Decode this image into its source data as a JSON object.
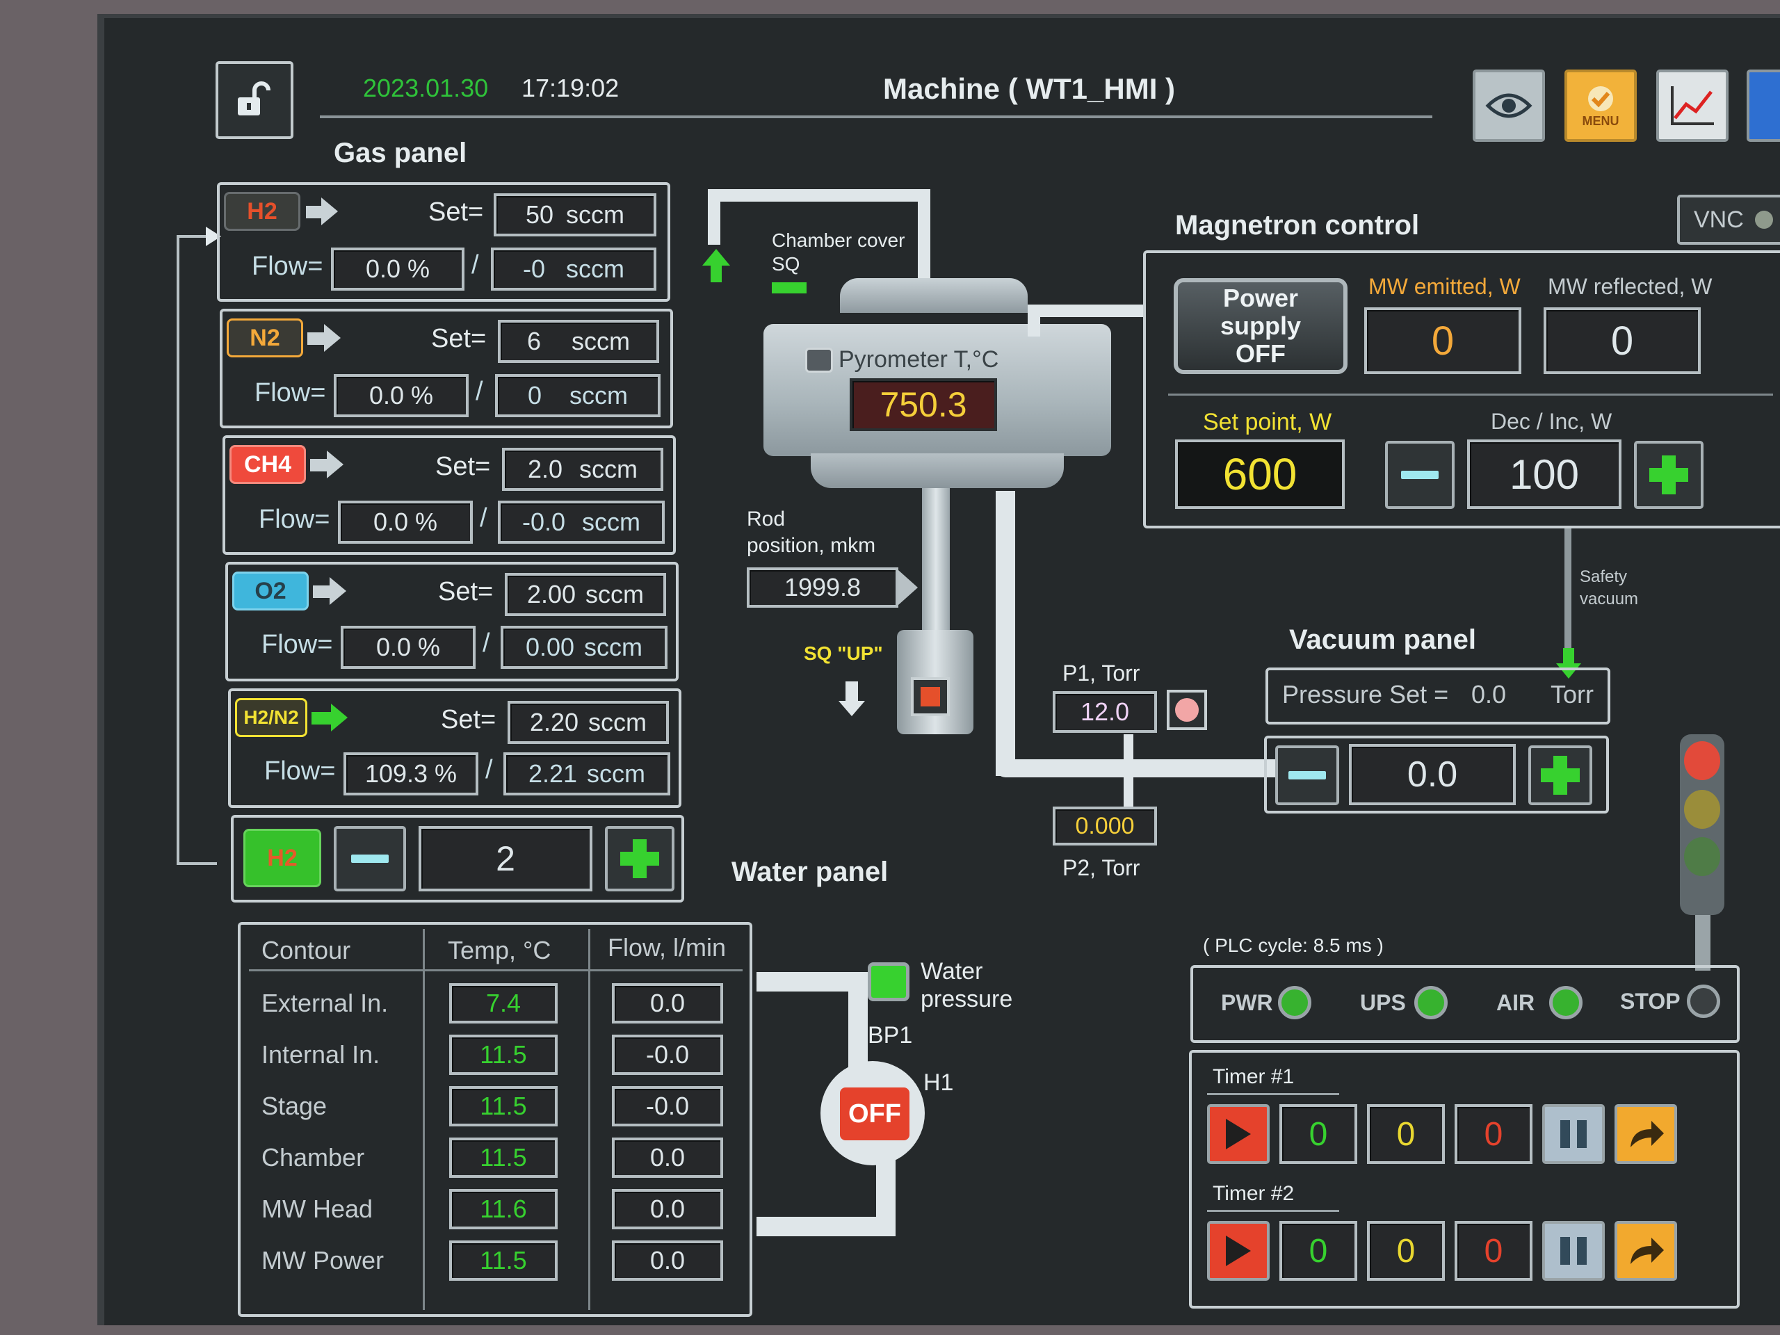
{
  "header": {
    "date": "2023.01.30",
    "time": "17:19:02",
    "machine_title": "Machine ( WT1_HMI )",
    "menu_label": "MENU",
    "vnc_label": "VNC"
  },
  "gas_panel": {
    "title": "Gas panel",
    "set_label": "Set=",
    "flow_label": "Flow=",
    "gases": [
      {
        "name": "H2",
        "set": "50",
        "unit": "sccm",
        "flow_pct": "0.0 %",
        "flow_sccm": "-0",
        "color": "#e5502b"
      },
      {
        "name": "N2",
        "set": "6",
        "unit": "sccm",
        "flow_pct": "0.0 %",
        "flow_sccm": "0",
        "color": "#f4a93a"
      },
      {
        "name": "CH4",
        "set": "2.0",
        "unit": "sccm",
        "flow_pct": "0.0 %",
        "flow_sccm": "-0.0",
        "color": "#ef4a3c"
      },
      {
        "name": "O2",
        "set": "2.00",
        "unit": "sccm",
        "flow_pct": "0.0 %",
        "flow_sccm": "0.00",
        "color": "#3fb6dc"
      },
      {
        "name": "H2/N2",
        "set": "2.20",
        "unit": "sccm",
        "flow_pct": "109.3 %",
        "flow_sccm": "2.21",
        "color": "#f2e233"
      }
    ],
    "selector": {
      "label": "H2",
      "value": "2"
    }
  },
  "chamber": {
    "cover_label_1": "Chamber cover",
    "cover_label_2": "SQ",
    "pyrometer_label": "Pyrometer T,°C",
    "pyrometer_value": "750.3",
    "rod_label_1": "Rod",
    "rod_label_2": "position, mkm",
    "rod_value": "1999.8",
    "sq_up_label": "SQ \"UP\""
  },
  "pressure": {
    "p1_label": "P1, Torr",
    "p1_value": "12.0",
    "p2_label": "P2, Torr",
    "p2_value": "0.000"
  },
  "magnetron": {
    "title": "Magnetron control",
    "power_button": "Power supply OFF",
    "mw_emitted_label": "MW emitted, W",
    "mw_emitted_value": "0",
    "mw_reflected_label": "MW reflected, W",
    "mw_reflected_value": "0",
    "set_point_label": "Set point, W",
    "set_point_value": "600",
    "dec_inc_label": "Dec / Inc, W",
    "dec_inc_value": "100"
  },
  "safety_vacuum": {
    "line1": "Safety",
    "line2": "vacuum"
  },
  "vacuum_panel": {
    "title": "Vacuum panel",
    "pressure_set_label": "Pressure Set =",
    "pressure_set_value": "0.0",
    "pressure_set_unit": "Torr",
    "stepper_value": "0.0"
  },
  "water_panel": {
    "title": "Water panel",
    "headers": [
      "Contour",
      "Temp, °C",
      "Flow, l/min"
    ],
    "rows": [
      {
        "contour": "External In.",
        "temp": "7.4",
        "flow": "0.0"
      },
      {
        "contour": "Internal In.",
        "temp": "11.5",
        "flow": "-0.0"
      },
      {
        "contour": "Stage",
        "temp": "11.5",
        "flow": "-0.0"
      },
      {
        "contour": "Chamber",
        "temp": "11.5",
        "flow": "0.0"
      },
      {
        "contour": "MW Head",
        "temp": "11.6",
        "flow": "0.0"
      },
      {
        "contour": "MW Power",
        "temp": "11.5",
        "flow": "0.0"
      }
    ],
    "water_pressure_1": "Water",
    "water_pressure_2": "pressure",
    "bp1_label": "BP1",
    "h1_label": "H1",
    "pump_state": "OFF"
  },
  "status": {
    "plc_cycle": "( PLC cycle: 8.5 ms )",
    "indicators": [
      "PWR",
      "UPS",
      "AIR",
      "STOP"
    ]
  },
  "timers": [
    {
      "label": "Timer #1",
      "v1": "0",
      "v2": "0",
      "v3": "0"
    },
    {
      "label": "Timer #2",
      "v1": "0",
      "v2": "0",
      "v3": "0"
    }
  ]
}
